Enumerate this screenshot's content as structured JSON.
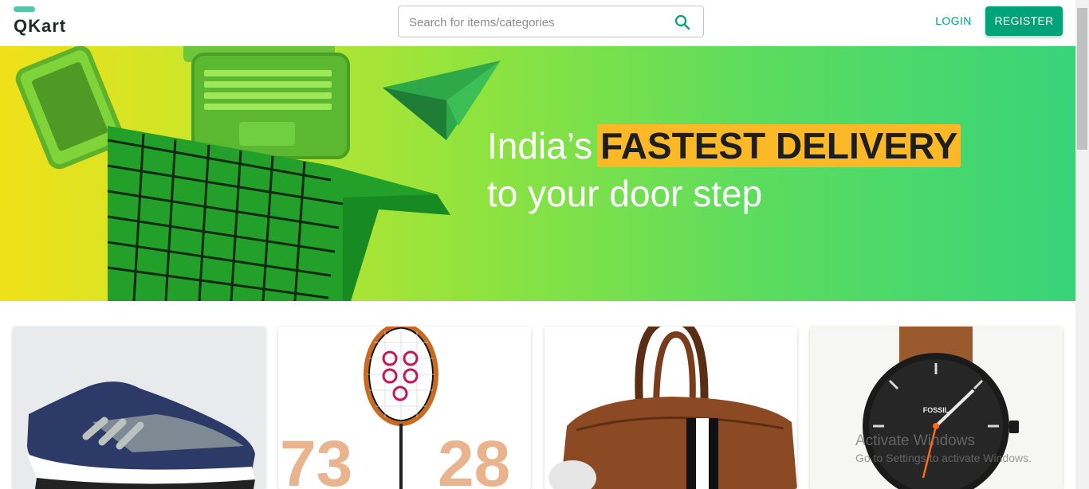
{
  "header": {
    "logo_text": "QKart",
    "search_placeholder": "Search for items/categories",
    "login_label": "LOGIN",
    "register_label": "REGISTER",
    "search_icon": "search-icon",
    "accent_color": "#00a278"
  },
  "hero": {
    "line1_prefix": "India’s",
    "line1_highlight": "FASTEST DELIVERY",
    "line2": "to your door step",
    "highlight_color": "#fbb928"
  },
  "products": [
    {
      "name": "shoe"
    },
    {
      "name": "badminton-racket",
      "text_left": "73",
      "text_right": "28"
    },
    {
      "name": "duffel-bag"
    },
    {
      "name": "watch",
      "brand": "FOSSIL"
    }
  ],
  "watermark": {
    "title": "Activate Windows",
    "subtitle": "Go to Settings to activate Windows."
  }
}
